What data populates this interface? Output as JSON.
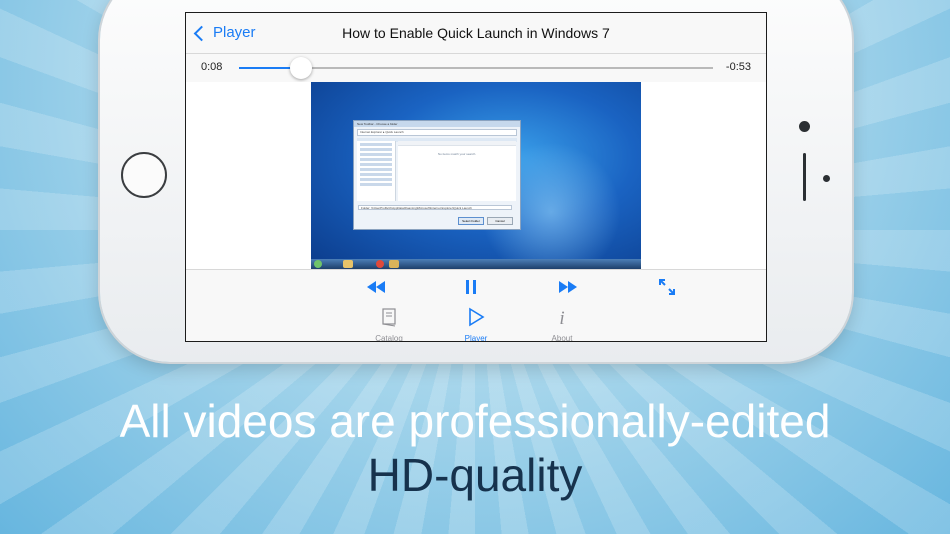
{
  "navbar": {
    "back_label": "Player",
    "title": "How to Enable Quick Launch in Windows 7"
  },
  "player": {
    "elapsed": "0:08",
    "remaining": "-0:53",
    "progress": 0.13
  },
  "video_frame": {
    "dialog_title": "New Toolbar - Choose a folder",
    "address": "Internet Explorer ▸ Quick Launch",
    "empty_message": "No items match your search.",
    "folder_path": "Folder: %UserProfile%\\AppData\\Roaming\\Microsoft\\Internet Explorer\\Quick Launch",
    "select_button": "Select Folder",
    "cancel_button": "Cancel"
  },
  "tabs": [
    {
      "label": "Catalog",
      "icon": "book-icon",
      "active": false
    },
    {
      "label": "Player",
      "icon": "play-icon",
      "active": true
    },
    {
      "label": "About",
      "icon": "info-icon",
      "active": false
    }
  ],
  "caption": {
    "line1": "All videos are professionally-edited",
    "line2": "HD-quality"
  },
  "colors": {
    "accent": "#1a7cf5",
    "inactive": "#8e8e93"
  }
}
